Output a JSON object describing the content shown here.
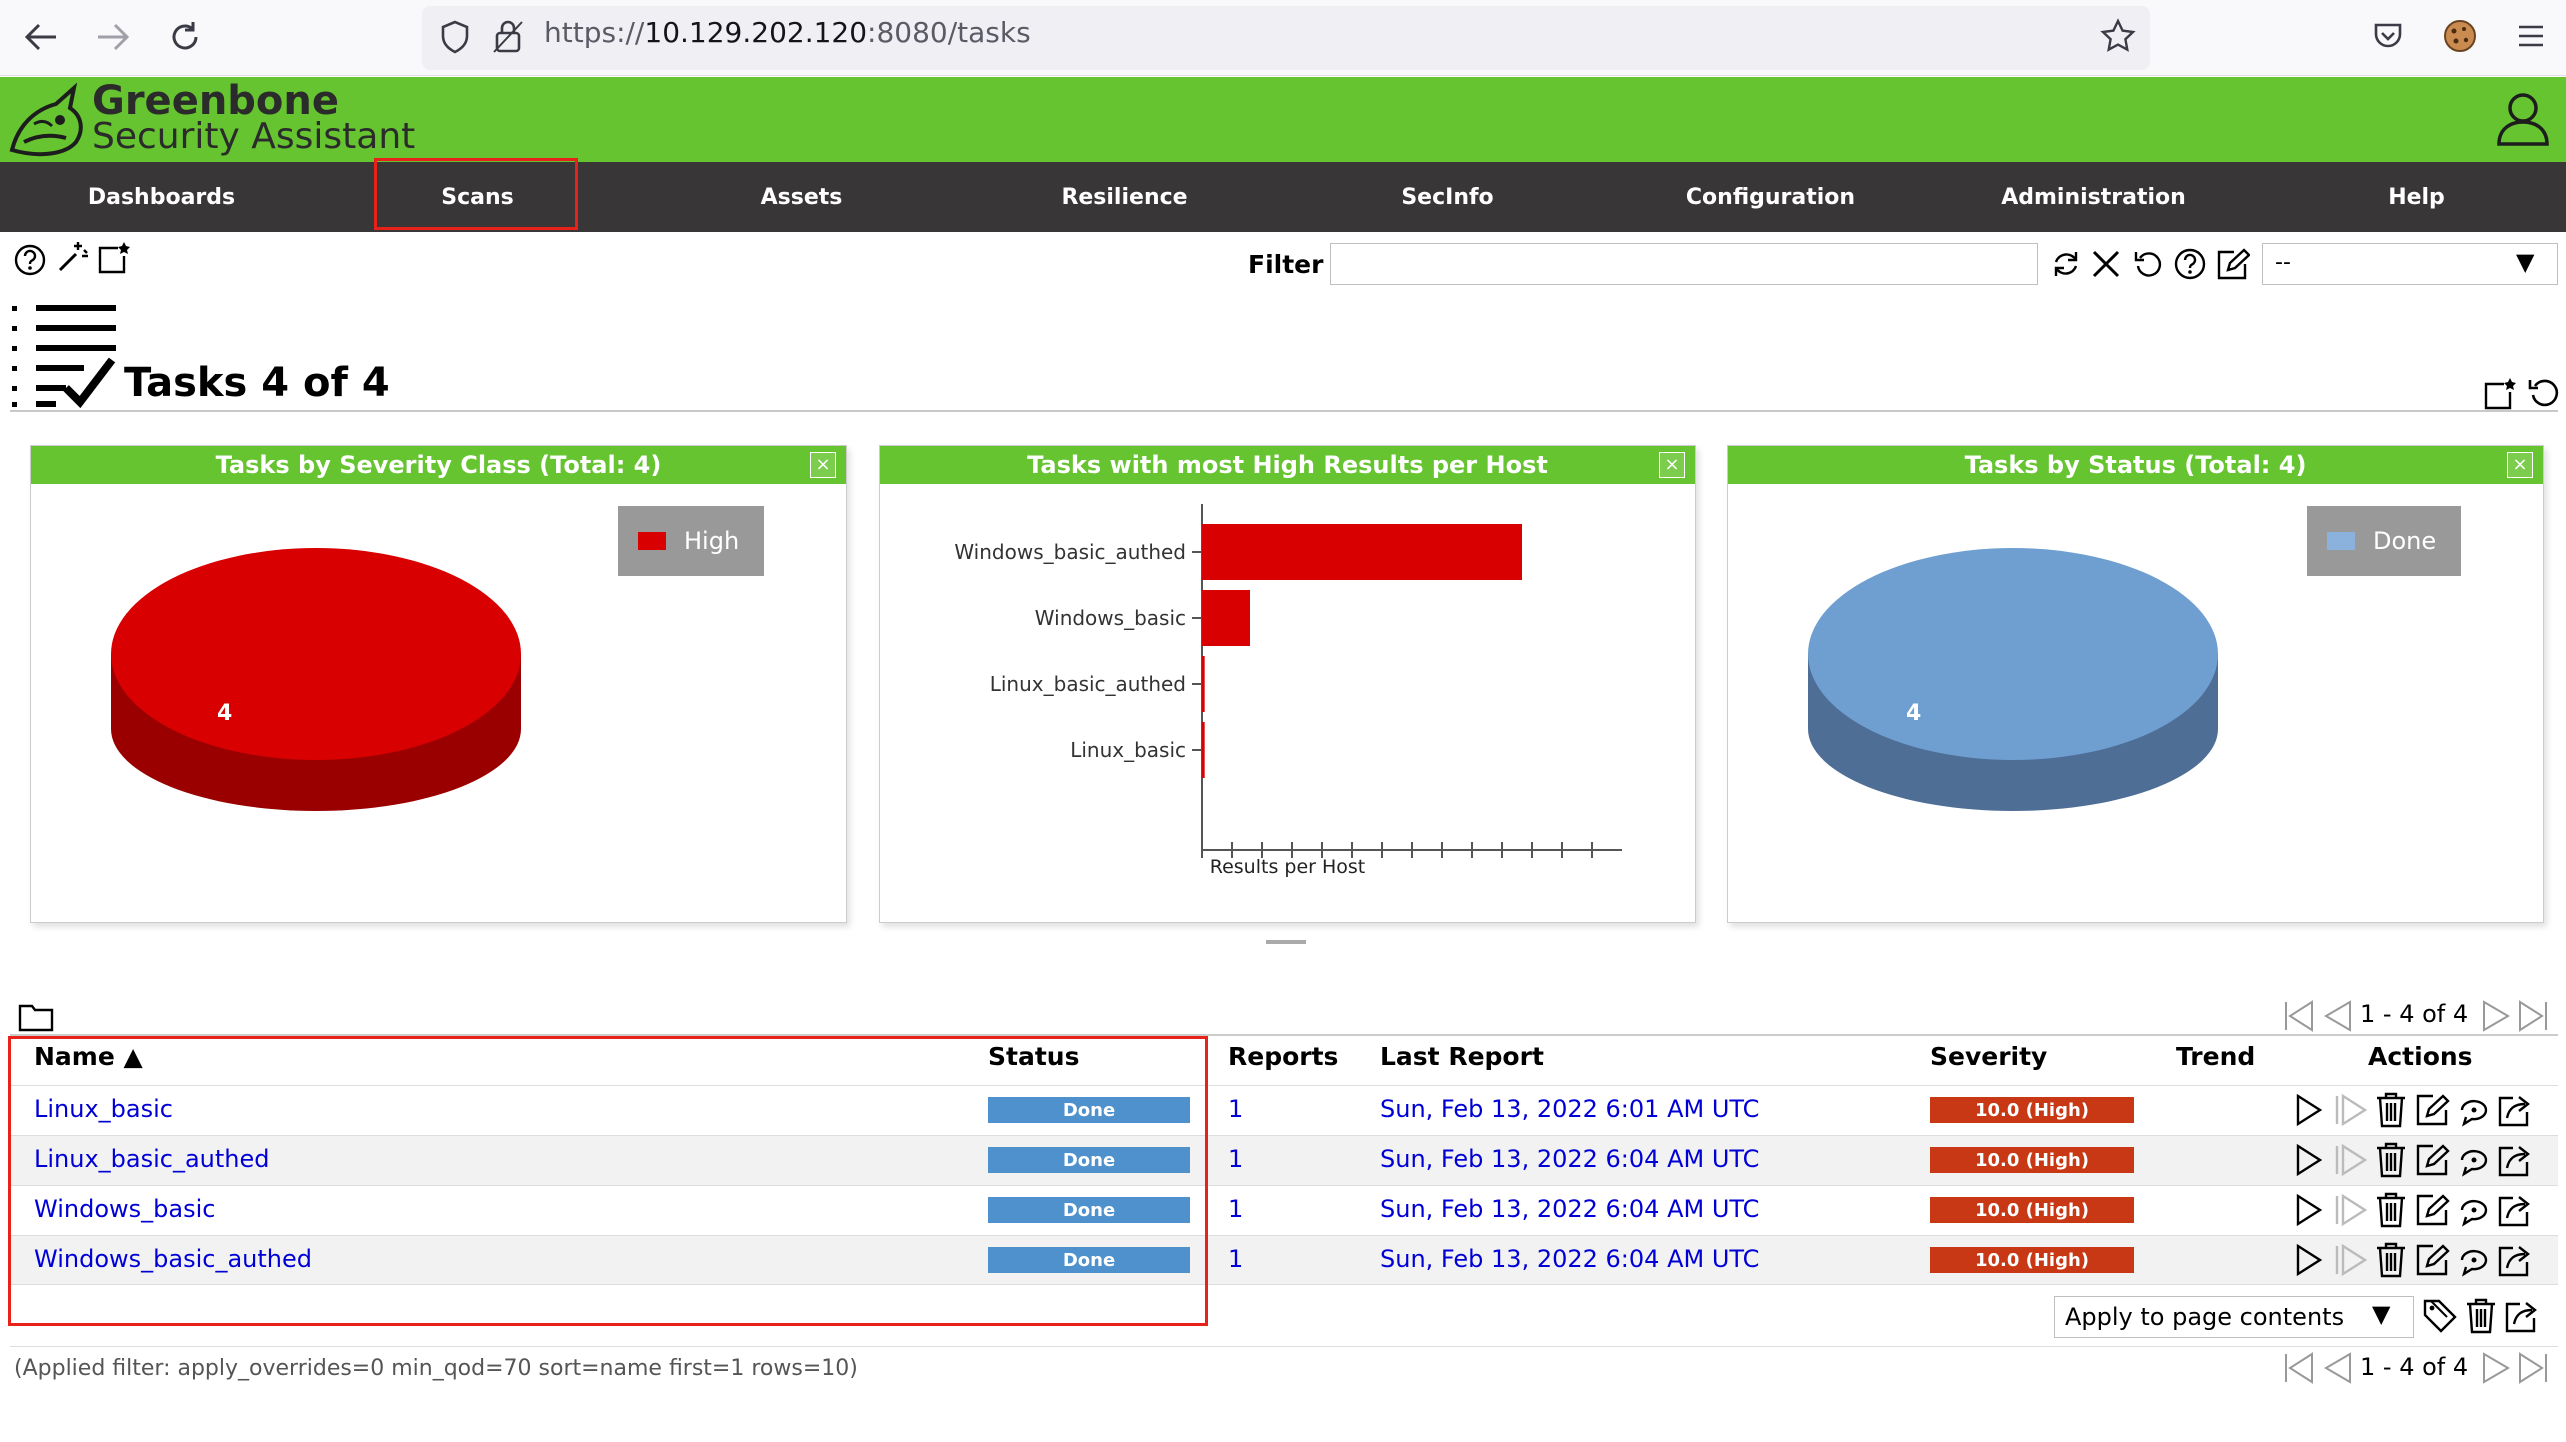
{
  "browser": {
    "url_prefix": "https://",
    "url_host": "10.129.202.120",
    "url_rest": ":8080/tasks",
    "icons": [
      "back-arrow-icon",
      "forward-arrow-icon",
      "reload-icon",
      "shield-icon",
      "lock-icon",
      "star-icon",
      "pocket-icon",
      "cookie-icon",
      "hamburger-menu-icon"
    ]
  },
  "app": {
    "logo_line1": "Greenbone",
    "logo_line2": "Security Assistant",
    "brand_color": "#66c430",
    "menu_color": "#393637"
  },
  "menu": {
    "items": [
      "Dashboards",
      "Scans",
      "Assets",
      "Resilience",
      "SecInfo",
      "Configuration",
      "Administration",
      "Help"
    ],
    "highlighted": "Scans"
  },
  "toolbar": {
    "filter_label": "Filter",
    "filter_value": "",
    "filter_select": "--"
  },
  "page": {
    "title": "Tasks 4 of 4"
  },
  "dashboard": {
    "panels": [
      {
        "title": "Tasks by Severity Class (Total: 4)",
        "legend": "High",
        "color": "#d80000"
      },
      {
        "title": "Tasks with most High Results per Host",
        "xlabel": "Results per Host"
      },
      {
        "title": "Tasks by Status (Total: 4)",
        "legend": "Done",
        "color": "#6f9fd0"
      }
    ],
    "close_label": "×"
  },
  "chart_data": [
    {
      "type": "pie",
      "title": "Tasks by Severity Class (Total: 4)",
      "slices": [
        {
          "label": "High",
          "value": 4,
          "color": "#d80000"
        }
      ]
    },
    {
      "type": "bar",
      "orientation": "horizontal",
      "title": "Tasks with most High Results per Host",
      "categories": [
        "Windows_basic_authed",
        "Windows_basic",
        "Linux_basic_authed",
        "Linux_basic"
      ],
      "values": [
        12.0,
        1.8,
        0.1,
        0.1
      ],
      "xlabel": "Results per Host",
      "xlim": [
        0,
        13.5
      ],
      "bar_color": "#d80000"
    },
    {
      "type": "pie",
      "title": "Tasks by Status (Total: 4)",
      "slices": [
        {
          "label": "Done",
          "value": 4,
          "color": "#6f9fd0"
        }
      ]
    }
  ],
  "table": {
    "headers": {
      "name": "Name ▲",
      "status": "Status",
      "reports": "Reports",
      "last_report": "Last Report",
      "severity": "Severity",
      "trend": "Trend",
      "actions": "Actions"
    },
    "rows": [
      {
        "name": "Linux_basic",
        "status": "Done",
        "reports": "1",
        "last_report": "Sun, Feb 13, 2022 6:01 AM UTC",
        "severity": "10.0 (High)"
      },
      {
        "name": "Linux_basic_authed",
        "status": "Done",
        "reports": "1",
        "last_report": "Sun, Feb 13, 2022 6:04 AM UTC",
        "severity": "10.0 (High)"
      },
      {
        "name": "Windows_basic",
        "status": "Done",
        "reports": "1",
        "last_report": "Sun, Feb 13, 2022 6:04 AM UTC",
        "severity": "10.0 (High)"
      },
      {
        "name": "Windows_basic_authed",
        "status": "Done",
        "reports": "1",
        "last_report": "Sun, Feb 13, 2022 6:04 AM UTC",
        "severity": "10.0 (High)"
      }
    ]
  },
  "pagination": {
    "label": "1 - 4 of 4"
  },
  "bulk": {
    "select_value": "Apply to page contents"
  },
  "applied_filter": "(Applied filter: apply_overrides=0 min_qod=70 sort=name first=1 rows=10)"
}
